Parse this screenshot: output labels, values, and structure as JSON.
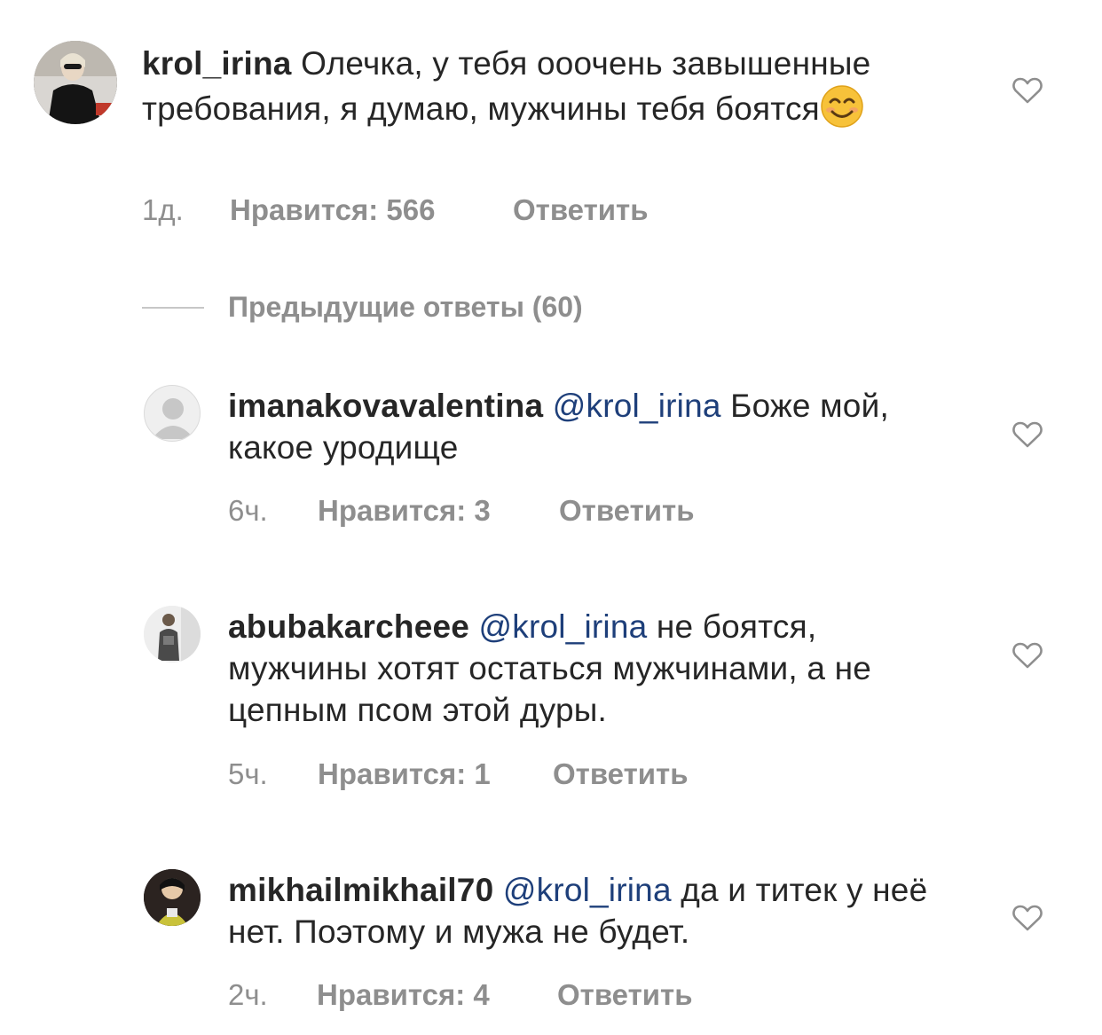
{
  "comments": [
    {
      "username": "krol_irina",
      "mention": "",
      "text": "Олечка, у тебя ооочень завышенные требования, я думаю, мужчины тебя боятся",
      "emoji": "smiling-face-emoji",
      "time": "1д.",
      "likes": "Нравится: 566",
      "reply": "Ответить",
      "avatar": "profile-photo-icon"
    },
    {
      "username": "imanakovavalentina",
      "mention": "@krol_irina",
      "text": "Боже мой, какое уродище",
      "time": "6ч.",
      "likes": "Нравится: 3",
      "reply": "Ответить",
      "avatar": "default-avatar-icon"
    },
    {
      "username": "abubakarcheee",
      "mention": "@krol_irina",
      "text": "не боятся, мужчины хотят остаться мужчинами, а не цепным псом этой дуры.",
      "time": "5ч.",
      "likes": "Нравится: 1",
      "reply": "Ответить",
      "avatar": "profile-photo-icon"
    },
    {
      "username": "mikhailmikhail70",
      "mention": "@krol_irina",
      "text": "да и титек у неё  нет. Поэтому и мужа не будет.",
      "time": "2ч.",
      "likes": "Нравится: 4",
      "reply": "Ответить",
      "avatar": "profile-photo-icon"
    }
  ],
  "previous_replies": "Предыдущие ответы (60)",
  "colors": {
    "mention": "#1e3f7a",
    "meta": "#8e8e8e",
    "text": "#262626"
  }
}
